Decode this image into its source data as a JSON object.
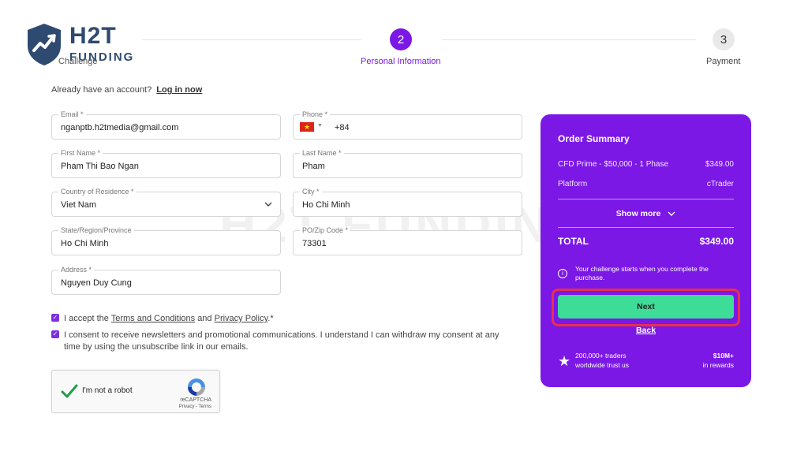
{
  "brand": {
    "name": "H2T",
    "sub": "FUNDING",
    "primary": "#7b18e6",
    "accent": "#3ddc97",
    "highlight": "#e8304d",
    "logo_color": "#2f4a70"
  },
  "watermark": "H2T FUNDING",
  "stepper": {
    "steps": [
      {
        "number": "",
        "label": "Challenge"
      },
      {
        "number": "2",
        "label": "Personal Information"
      },
      {
        "number": "3",
        "label": "Payment"
      }
    ],
    "active_index": 1
  },
  "account": {
    "prompt": "Already have an account?",
    "link": "Log in now"
  },
  "form": {
    "email": {
      "label": "Email *",
      "value": "nganptb.h2tmedia@gmail.com"
    },
    "phone": {
      "label": "Phone *",
      "value": "+84",
      "flag": "vietnam-flag-icon"
    },
    "first_name": {
      "label": "First Name *",
      "value": "Pham Thi Bao Ngan"
    },
    "last_name": {
      "label": "Last Name *",
      "value": "Pham"
    },
    "country": {
      "label": "Country of Residence *",
      "value": "Viet Nam"
    },
    "city": {
      "label": "City *",
      "value": "Ho Chi Minh"
    },
    "state": {
      "label": "State/Region/Province",
      "value": "Ho Chi Minh"
    },
    "zip": {
      "label": "PO/Zip Code *",
      "value": "73301"
    },
    "address": {
      "label": "Address *",
      "value": "Nguyen Duy Cung"
    }
  },
  "consent": {
    "terms": {
      "prefix": "I accept the",
      "terms_link": "Terms and Conditions",
      "and": "and",
      "privacy_link": "Privacy Policy",
      "suffix": ".*",
      "checked": true
    },
    "newsletter": {
      "text": "I consent to receive newsletters and promotional communications. I understand I can withdraw my consent at any time by using the unsubscribe link in our emails.",
      "checked": true
    }
  },
  "recaptcha": {
    "label": "I'm not a robot",
    "brand": "reCAPTCHA",
    "terms": "Privacy - Terms",
    "checked": true
  },
  "summary": {
    "title": "Order Summary",
    "items": [
      {
        "name": "CFD Prime - $50,000 - 1 Phase",
        "value": "$349.00"
      },
      {
        "name": "Platform",
        "value": "cTrader"
      }
    ],
    "show_more": "Show more",
    "total_label": "TOTAL",
    "total_value": "$349.00",
    "info": "Your challenge starts when you complete the purchase.",
    "next": "Next",
    "back": "Back",
    "trust_line1": "200,000+ traders",
    "trust_line2": "worldwide trust us",
    "rewards_value": "$10M+",
    "rewards_label": "in rewards"
  }
}
